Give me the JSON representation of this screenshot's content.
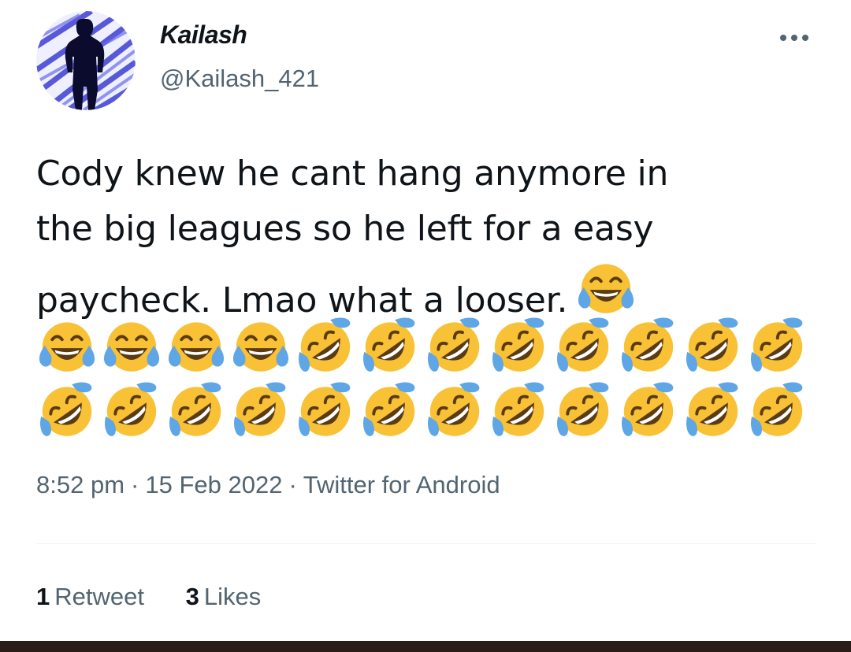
{
  "tweet": {
    "display_name": "Kailash",
    "handle": "@Kailash_421",
    "text_lines": [
      "Cody knew he cant hang anymore in",
      "the big leagues so he left for a easy",
      "paycheck. Lmao what a looser."
    ],
    "inline_emoji": "face-with-tears-of-joy",
    "emoji_rows": [
      [
        "face-with-tears-of-joy",
        "face-with-tears-of-joy",
        "face-with-tears-of-joy",
        "face-with-tears-of-joy",
        "rolling-on-floor-laughing",
        "rolling-on-floor-laughing",
        "rolling-on-floor-laughing",
        "rolling-on-floor-laughing",
        "rolling-on-floor-laughing",
        "rolling-on-floor-laughing",
        "rolling-on-floor-laughing",
        "rolling-on-floor-laughing"
      ],
      [
        "rolling-on-floor-laughing",
        "rolling-on-floor-laughing",
        "rolling-on-floor-laughing",
        "rolling-on-floor-laughing",
        "rolling-on-floor-laughing",
        "rolling-on-floor-laughing",
        "rolling-on-floor-laughing",
        "rolling-on-floor-laughing",
        "rolling-on-floor-laughing",
        "rolling-on-floor-laughing",
        "rolling-on-floor-laughing",
        "rolling-on-floor-laughing"
      ]
    ],
    "time": "8:52 pm",
    "date": "15 Feb 2022",
    "source": "Twitter for Android",
    "separator": "·",
    "retweets": {
      "count": "1",
      "label": "Retweet"
    },
    "likes": {
      "count": "3",
      "label": "Likes"
    }
  },
  "icons": {
    "more": "more-horizontal-icon",
    "avatar": "profile-avatar"
  },
  "colors": {
    "text": "#0f1419",
    "secondary": "#536471",
    "emoji_face": "#f8c136",
    "emoji_tear": "#5ea6e5",
    "avatar_blue": "#3c3fd2"
  }
}
